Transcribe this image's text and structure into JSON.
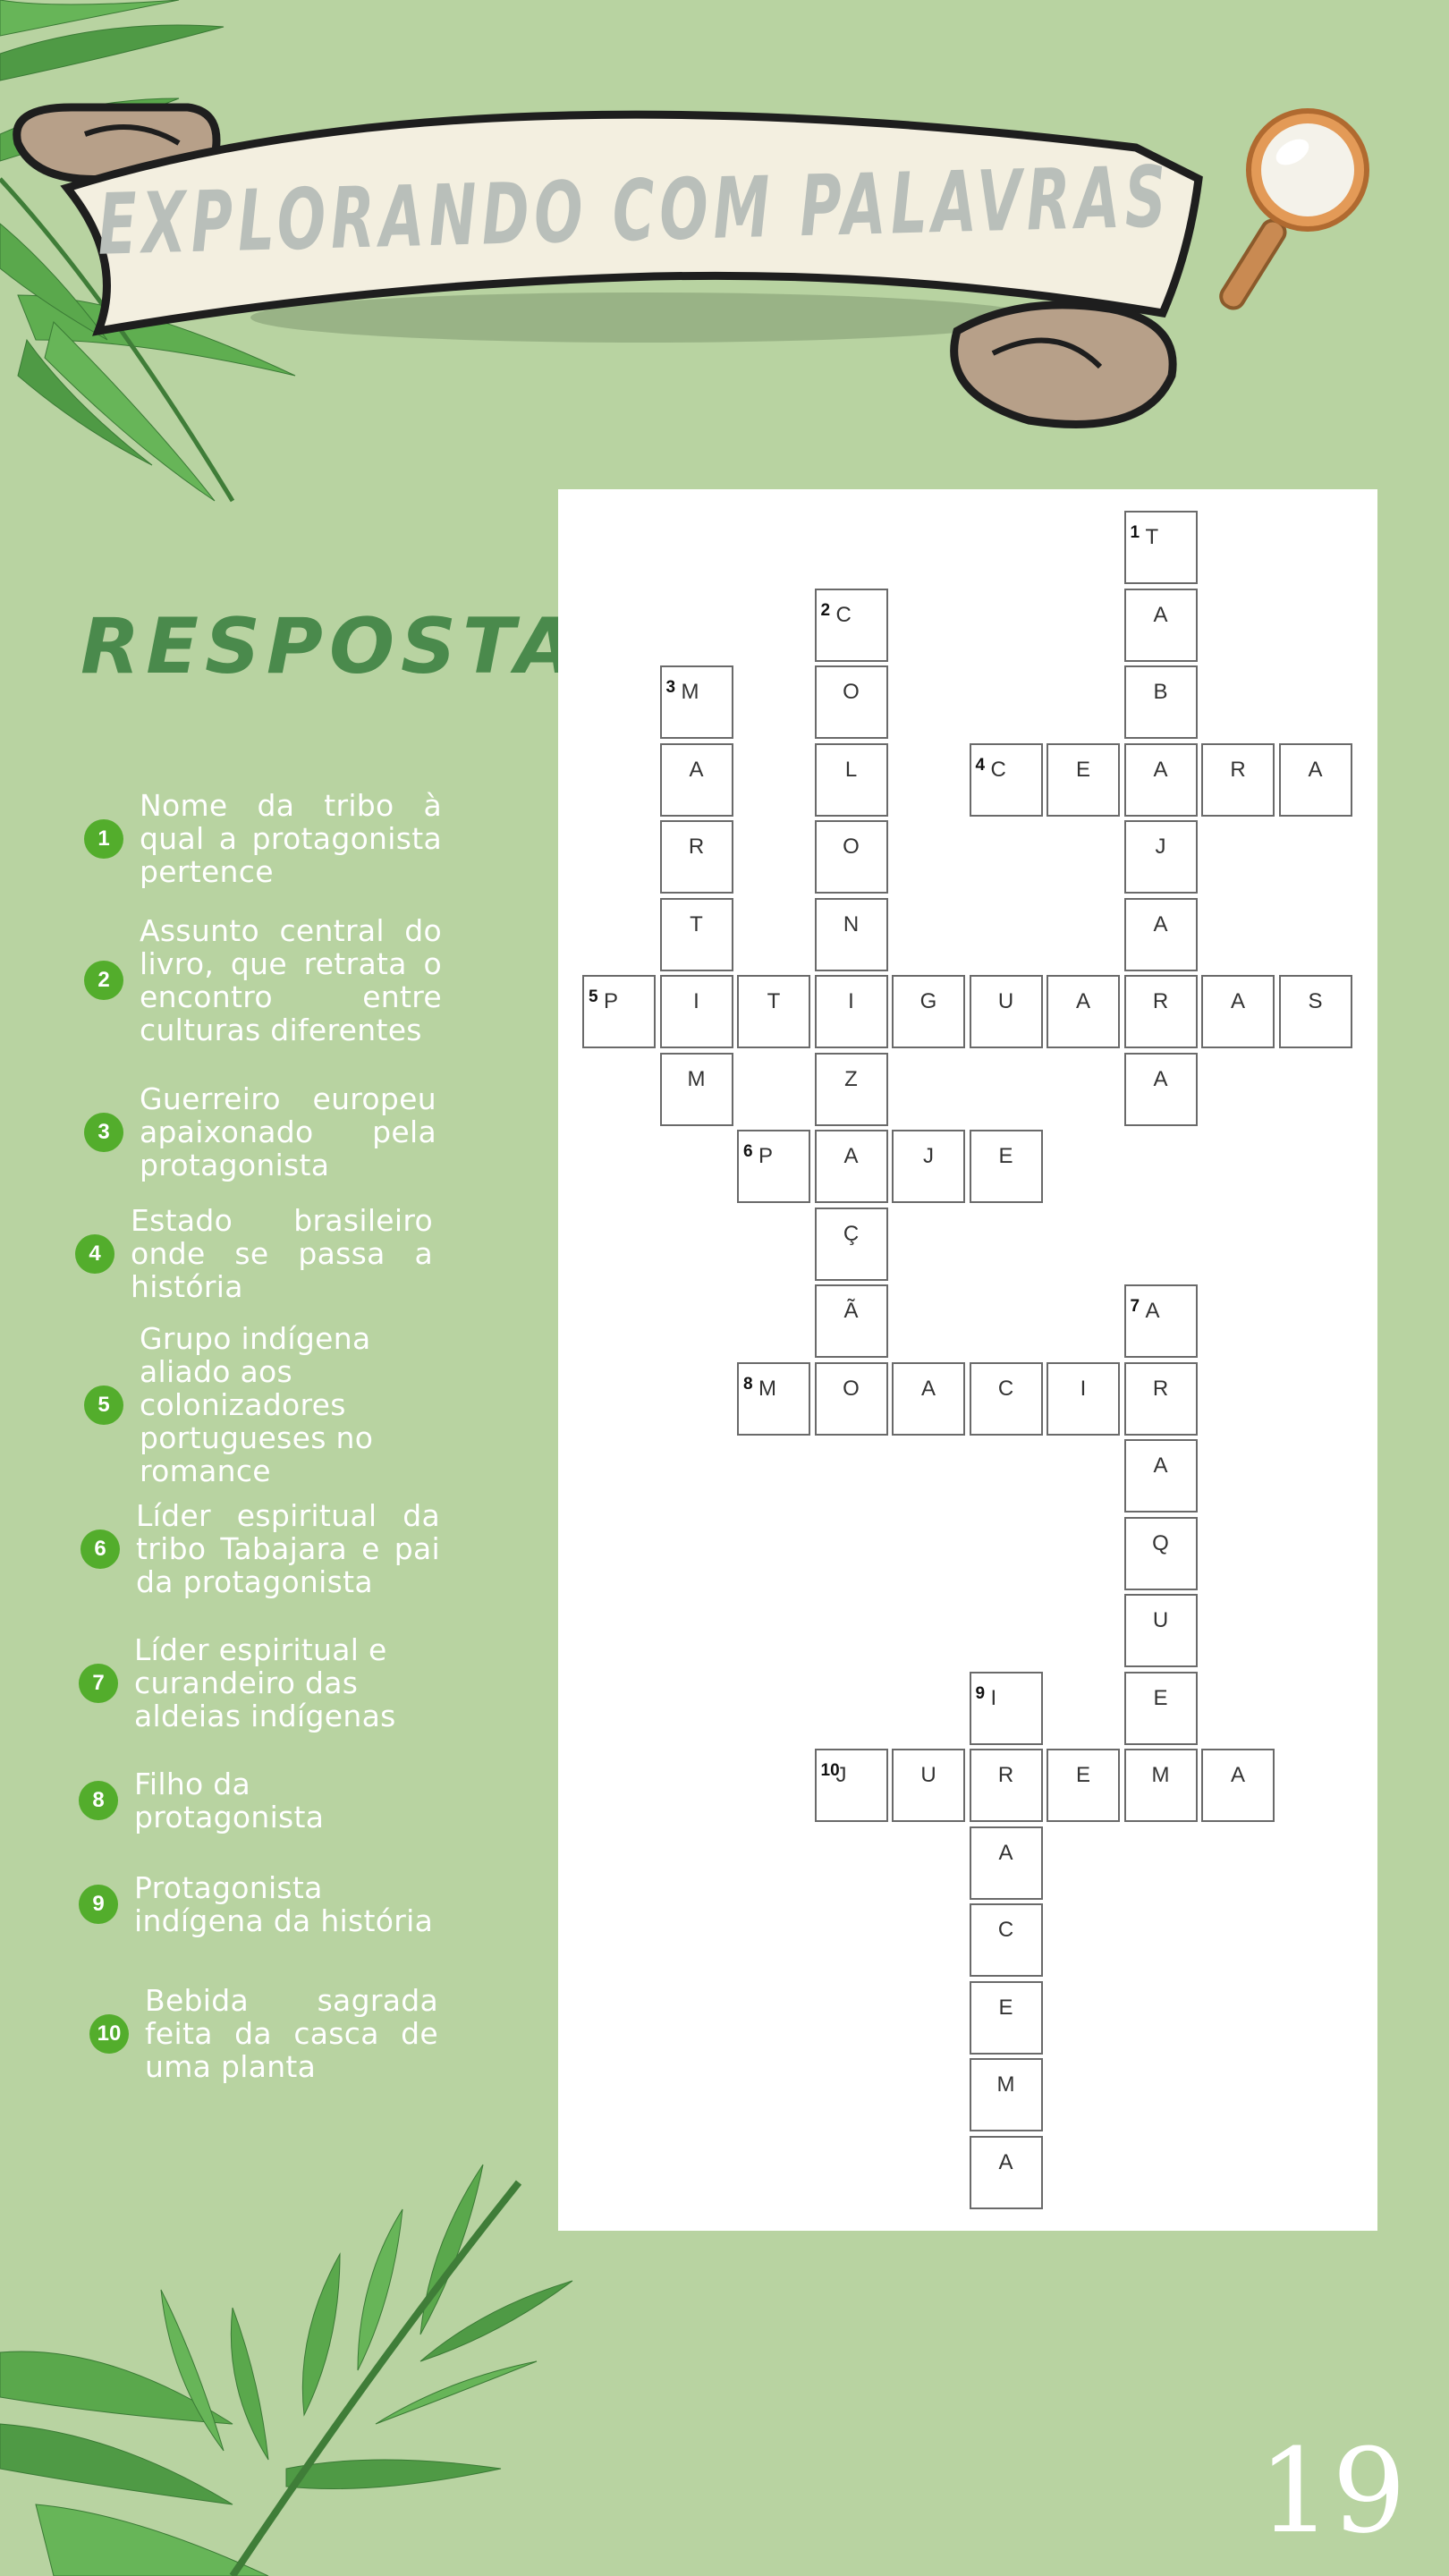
{
  "banner_title": "EXPLORANDO COM PALAVRAS",
  "heading": "RESPOSTAS",
  "clues": [
    {
      "num": "1",
      "text": "Nome da tribo à qual a protagonista pertence"
    },
    {
      "num": "2",
      "text": "Assunto central do livro, que retrata o encontro entre culturas diferentes"
    },
    {
      "num": "3",
      "text": "Guerreiro europeu apaixonado pela protagonista"
    },
    {
      "num": "4",
      "text": "Estado brasileiro onde se passa a história"
    },
    {
      "num": "5",
      "text": "Grupo indígena aliado aos colonizadores portugueses no romance"
    },
    {
      "num": "6",
      "text": "Líder espiritual da tribo Tabajara e pai da protagonista"
    },
    {
      "num": "7",
      "text": "Líder espiritual e curandeiro das aldeias indígenas"
    },
    {
      "num": "8",
      "text": "Filho da protagonista"
    },
    {
      "num": "9",
      "text": "Protagonista indígena da história"
    },
    {
      "num": "10",
      "text": "Bebida sagrada feita da casca de uma planta"
    }
  ],
  "crossword": {
    "words": [
      {
        "num": "1",
        "answer": "TABAJARA",
        "dir": "down",
        "row": 0,
        "col": 7
      },
      {
        "num": "2",
        "answer": "COLONIZAÇÃO",
        "dir": "down",
        "row": 1,
        "col": 3
      },
      {
        "num": "3",
        "answer": "MARTIM",
        "dir": "down",
        "row": 2,
        "col": 1
      },
      {
        "num": "4",
        "answer": "CEARA",
        "dir": "across",
        "row": 3,
        "col": 5
      },
      {
        "num": "5",
        "answer": "PITIGUARAS",
        "dir": "across",
        "row": 6,
        "col": 0
      },
      {
        "num": "6",
        "answer": "PAJE",
        "dir": "across",
        "row": 8,
        "col": 2
      },
      {
        "num": "7",
        "answer": "ARAQUEM",
        "dir": "down",
        "row": 10,
        "col": 7
      },
      {
        "num": "8",
        "answer": "MOACIR",
        "dir": "across",
        "row": 11,
        "col": 2
      },
      {
        "num": "9",
        "answer": "IRACEMA",
        "dir": "down",
        "row": 15,
        "col": 5
      },
      {
        "num": "10",
        "answer": "JUREMA",
        "dir": "across",
        "row": 16,
        "col": 3
      }
    ]
  },
  "page_number": "19",
  "colors": {
    "background": "#b8d3a1",
    "heading": "#4a8a4c",
    "clue_badge": "#53ad2c",
    "banner_paper": "#f3efe0",
    "banner_text": "#b9bfba"
  }
}
